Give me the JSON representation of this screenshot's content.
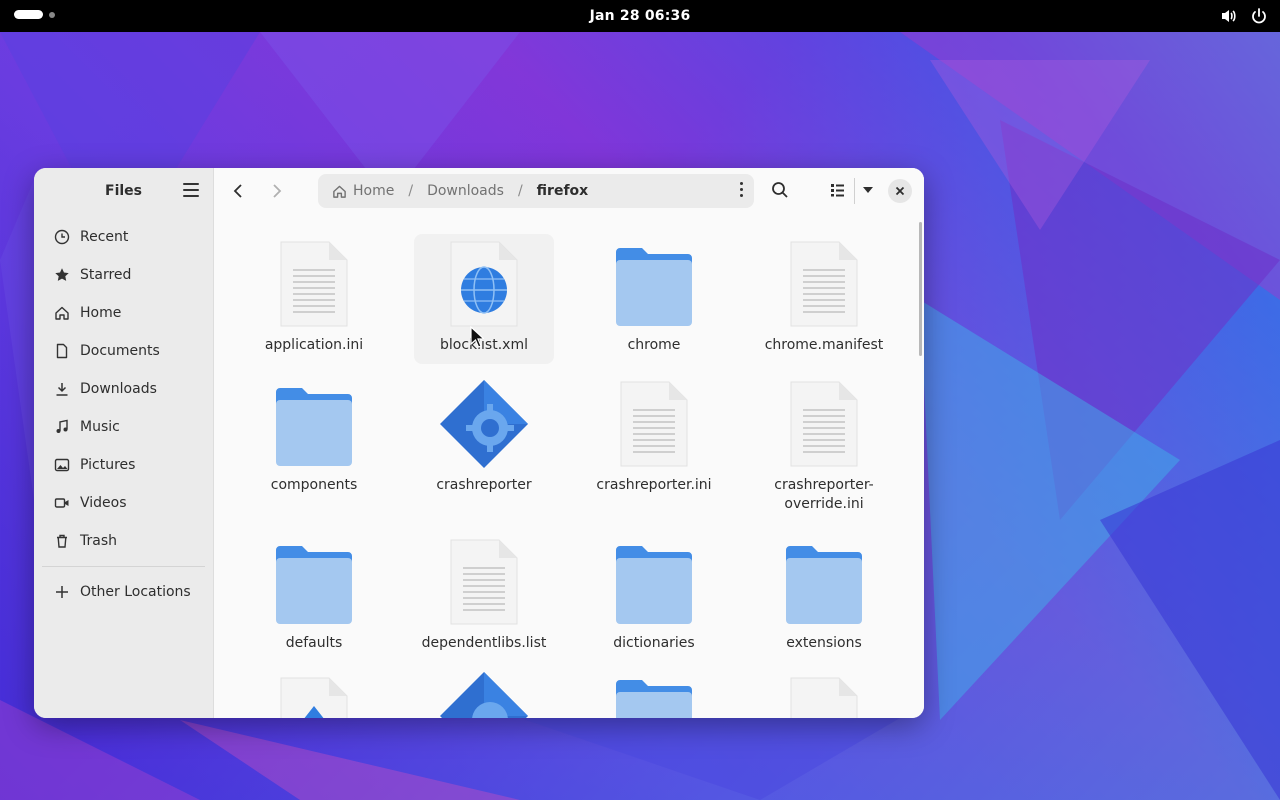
{
  "topbar": {
    "clock": "Jan 28  06:36"
  },
  "window": {
    "sidebar_title": "Files",
    "places": [
      {
        "label": "Recent",
        "icon": "clock-icon"
      },
      {
        "label": "Starred",
        "icon": "star-icon"
      },
      {
        "label": "Home",
        "icon": "home-icon"
      },
      {
        "label": "Documents",
        "icon": "document-icon"
      },
      {
        "label": "Downloads",
        "icon": "download-icon"
      },
      {
        "label": "Music",
        "icon": "music-icon"
      },
      {
        "label": "Pictures",
        "icon": "picture-icon"
      },
      {
        "label": "Videos",
        "icon": "video-icon"
      },
      {
        "label": "Trash",
        "icon": "trash-icon"
      }
    ],
    "other_locations": "Other Locations",
    "path": {
      "home": "Home",
      "downloads": "Downloads",
      "current": "firefox"
    },
    "files": [
      {
        "name": "application.ini",
        "type": "text"
      },
      {
        "name": "blocklist.xml",
        "type": "xml"
      },
      {
        "name": "chrome",
        "type": "folder"
      },
      {
        "name": "chrome.manifest",
        "type": "text"
      },
      {
        "name": "components",
        "type": "folder"
      },
      {
        "name": "crashreporter",
        "type": "executable"
      },
      {
        "name": "crashreporter.ini",
        "type": "text"
      },
      {
        "name": "crashreporter-\noverride.ini",
        "type": "text"
      },
      {
        "name": "defaults",
        "type": "folder"
      },
      {
        "name": "dependentlibs.list",
        "type": "text"
      },
      {
        "name": "dictionaries",
        "type": "folder"
      },
      {
        "name": "extensions",
        "type": "folder"
      }
    ]
  },
  "colors": {
    "folder": "#438de6",
    "folder_light": "#a4c8f0",
    "accent": "#3584e4"
  }
}
